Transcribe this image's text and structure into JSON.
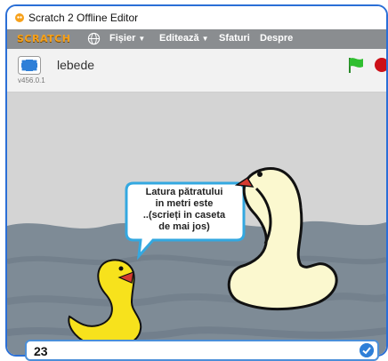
{
  "window": {
    "title": "Scratch 2 Offline Editor"
  },
  "menubar": {
    "logo": "SCRATCH",
    "items": [
      {
        "label": "Fișier",
        "caret": "▼"
      },
      {
        "label": "Editează",
        "caret": "▼"
      },
      {
        "label": "Sfaturi",
        "caret": ""
      },
      {
        "label": "Despre",
        "caret": ""
      }
    ]
  },
  "stage_header": {
    "project_name": "lebede",
    "version": "v456.0.1"
  },
  "stage": {
    "speech_bubble": "Latura pătratului\nin metri este\n..(scrieți in caseta\nde mai jos)"
  },
  "ask": {
    "answer_value": "23"
  },
  "colors": {
    "accent": "#2b6fd6",
    "menubar": "#8a8d90",
    "stop": "#cc1018",
    "flag": "#2fbf2f"
  },
  "icons": [
    "scratch-cat-icon",
    "globe-icon",
    "presentation-mode-icon",
    "green-flag-icon",
    "stop-icon",
    "checkmark-icon"
  ]
}
